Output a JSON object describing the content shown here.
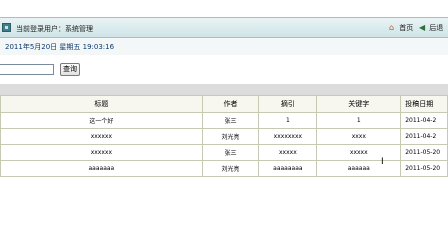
{
  "header": {
    "user_label": "当前登录用户：系统管理",
    "home_label": "首页",
    "back_label": "后退"
  },
  "date_bar": {
    "text": "2011年5月20日  星期五  19:03:16"
  },
  "search": {
    "value": "",
    "button_label": "查询"
  },
  "table": {
    "columns": [
      "标题",
      "作者",
      "摘引",
      "关键字",
      "投稿日期"
    ],
    "rows": [
      [
        "这一个好",
        "张三",
        "1",
        "1",
        "2011-04-2"
      ],
      [
        "xxxxxx",
        "刘光亮",
        "xxxxxxxx",
        "xxxx",
        "2011-04-2"
      ],
      [
        "xxxxxx",
        "张三",
        "xxxxx",
        "xxxxx",
        "2011-05-20"
      ],
      [
        "aaaaaaa",
        "刘光亮",
        "aaaaaaaa",
        "aaaaaa",
        "2011-05-20"
      ]
    ]
  },
  "icons": {
    "user": "user-icon",
    "home": "home-icon",
    "back": "back-icon"
  },
  "colors": {
    "header_gradient_top": "#e9f3f4",
    "header_gradient_bottom": "#cfe4e7",
    "date_text": "#0d3a6e",
    "grid_border": "#c5cbb2",
    "header_cell_bg": "#f7f7ef"
  }
}
